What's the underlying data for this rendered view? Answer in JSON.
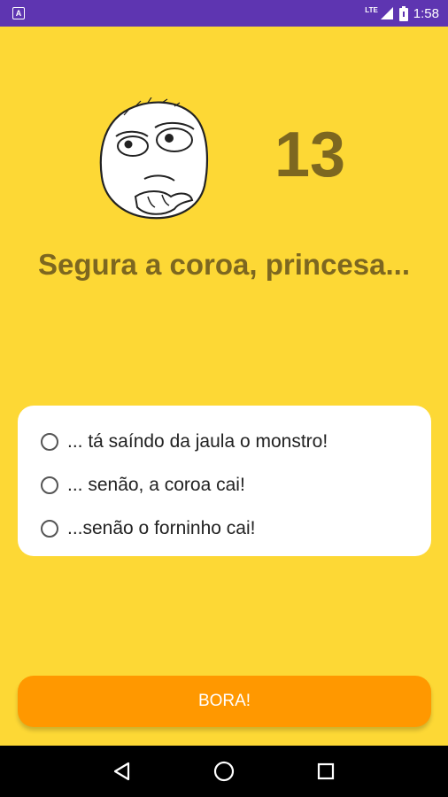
{
  "status_bar": {
    "notification_icon": "app-notification-icon",
    "notification_glyph": "A",
    "network": "LTE",
    "time": "1:58"
  },
  "quiz": {
    "countdown": "13",
    "question": "Segura a coroa, princesa...",
    "options": [
      "... tá saíndo da jaula o monstro!",
      "... senão, a coroa cai!",
      "...senão o forninho cai!"
    ],
    "submit_label": "BORA!"
  },
  "colors": {
    "background": "#FDD835",
    "accent_text": "#7D6720",
    "button": "#FF9800",
    "status_bar": "#5E35B1"
  },
  "nav_bar": {
    "icons": [
      "back-icon",
      "home-icon",
      "recents-icon"
    ]
  }
}
